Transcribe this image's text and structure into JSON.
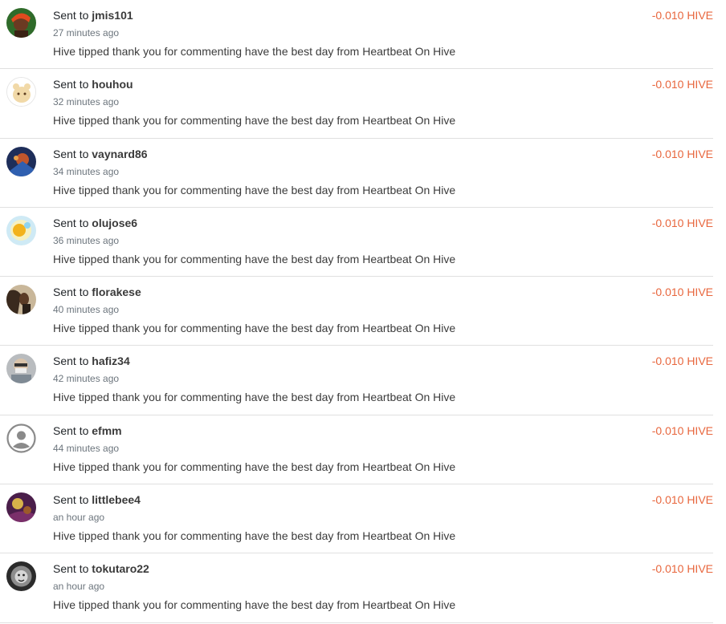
{
  "colors": {
    "amount": "#e8663d",
    "divider": "#e0e0e0",
    "muted": "#6c757d"
  },
  "transfers": [
    {
      "prefix": "Sent to",
      "user": "jmis101",
      "time": "27 minutes ago",
      "memo": "Hive tipped thank you for commenting have the best day from Heartbeat On Hive",
      "amount": "-0.010 HIVE",
      "avatar_icon": "user-avatar-icon"
    },
    {
      "prefix": "Sent to",
      "user": "houhou",
      "time": "32 minutes ago",
      "memo": "Hive tipped thank you for commenting have the best day from Heartbeat On Hive",
      "amount": "-0.010 HIVE",
      "avatar_icon": "user-avatar-icon"
    },
    {
      "prefix": "Sent to",
      "user": "vaynard86",
      "time": "34 minutes ago",
      "memo": "Hive tipped thank you for commenting have the best day from Heartbeat On Hive",
      "amount": "-0.010 HIVE",
      "avatar_icon": "user-avatar-icon"
    },
    {
      "prefix": "Sent to",
      "user": "olujose6",
      "time": "36 minutes ago",
      "memo": "Hive tipped thank you for commenting have the best day from Heartbeat On Hive",
      "amount": "-0.010 HIVE",
      "avatar_icon": "user-avatar-icon"
    },
    {
      "prefix": "Sent to",
      "user": "florakese",
      "time": "40 minutes ago",
      "memo": "Hive tipped thank you for commenting have the best day from Heartbeat On Hive",
      "amount": "-0.010 HIVE",
      "avatar_icon": "user-avatar-icon"
    },
    {
      "prefix": "Sent to",
      "user": "hafiz34",
      "time": "42 minutes ago",
      "memo": "Hive tipped thank you for commenting have the best day from Heartbeat On Hive",
      "amount": "-0.010 HIVE",
      "avatar_icon": "user-avatar-icon"
    },
    {
      "prefix": "Sent to",
      "user": "efmm",
      "time": "44 minutes ago",
      "memo": "Hive tipped thank you for commenting have the best day from Heartbeat On Hive",
      "amount": "-0.010 HIVE",
      "avatar_icon": "default-user-icon"
    },
    {
      "prefix": "Sent to",
      "user": "littlebee4",
      "time": "an hour ago",
      "memo": "Hive tipped thank you for commenting have the best day from Heartbeat On Hive",
      "amount": "-0.010 HIVE",
      "avatar_icon": "user-avatar-icon"
    },
    {
      "prefix": "Sent to",
      "user": "tokutaro22",
      "time": "an hour ago",
      "memo": "Hive tipped thank you for commenting have the best day from Heartbeat On Hive",
      "amount": "-0.010 HIVE",
      "avatar_icon": "user-avatar-icon"
    }
  ]
}
